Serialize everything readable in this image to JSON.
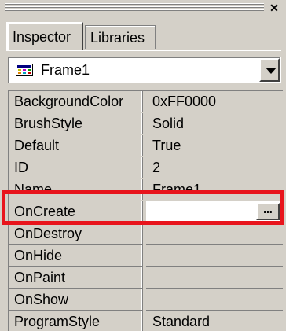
{
  "window": {
    "close_glyph": "✕"
  },
  "tabs": [
    {
      "label": "Inspector",
      "active": true
    },
    {
      "label": "Libraries",
      "active": false
    }
  ],
  "object_selector": {
    "icon": "frame-icon",
    "value": "Frame1"
  },
  "properties": [
    {
      "name": "BackgroundColor",
      "value": "0xFF0000"
    },
    {
      "name": "BrushStyle",
      "value": "Solid"
    },
    {
      "name": "Default",
      "value": "True"
    },
    {
      "name": "ID",
      "value": "2"
    },
    {
      "name": "Name",
      "value": "Frame1"
    },
    {
      "name": "OnCreate",
      "value": "",
      "editing": true,
      "button_label": "..."
    },
    {
      "name": "OnDestroy",
      "value": ""
    },
    {
      "name": "OnHide",
      "value": ""
    },
    {
      "name": "OnPaint",
      "value": ""
    },
    {
      "name": "OnShow",
      "value": ""
    },
    {
      "name": "ProgramStyle",
      "value": "Standard"
    }
  ],
  "colors": {
    "highlight": "#e8141c",
    "face": "#d4d0c8"
  }
}
